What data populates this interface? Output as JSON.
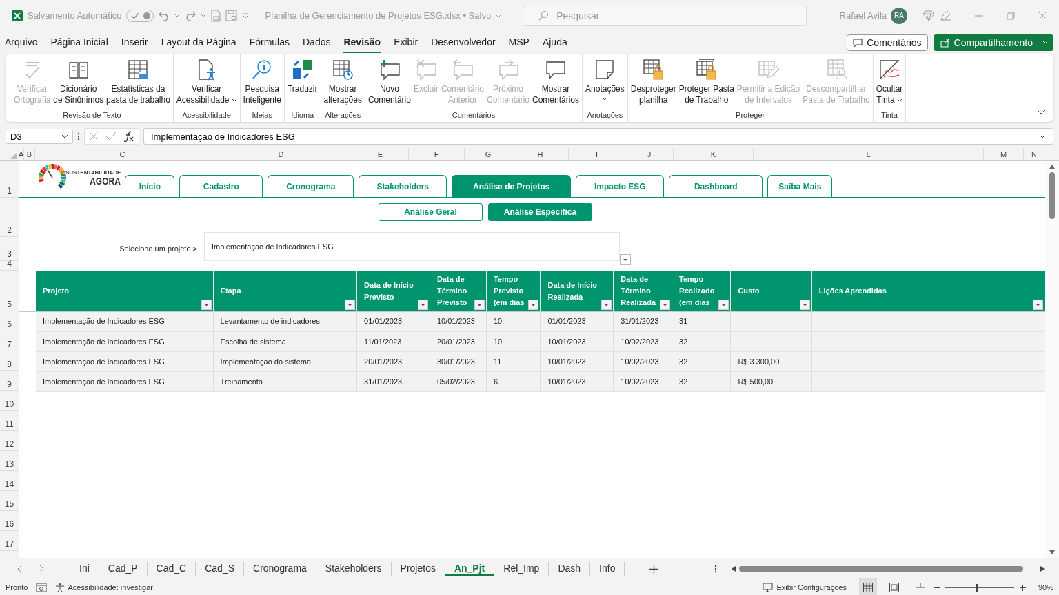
{
  "titlebar": {
    "autosave_label": "Salvamento Automático",
    "autosave_on": true,
    "file_title": "Planilha de Gerenciamento de Projetos ESG.xlsx • Salvo",
    "search_placeholder": "Pesquisar",
    "user_name": "Rafael Avila",
    "avatar_initials": "RA"
  },
  "menu": [
    {
      "label": "Arquivo",
      "selected": false
    },
    {
      "label": "Página Inicial",
      "selected": false
    },
    {
      "label": "Inserir",
      "selected": false
    },
    {
      "label": "Layout da Página",
      "selected": false
    },
    {
      "label": "Fórmulas",
      "selected": false
    },
    {
      "label": "Dados",
      "selected": false
    },
    {
      "label": "Revisão",
      "selected": true
    },
    {
      "label": "Exibir",
      "selected": false
    },
    {
      "label": "Desenvolvedor",
      "selected": false
    },
    {
      "label": "MSP",
      "selected": false
    },
    {
      "label": "Ajuda",
      "selected": false
    }
  ],
  "menu_buttons": {
    "comments": "Comentários",
    "share": "Compartilhamento"
  },
  "ribbon": [
    {
      "label": "Revisão de Texto",
      "items": [
        {
          "lines": [
            "Verificar",
            "Ortografia"
          ],
          "disabled": true
        },
        {
          "lines": [
            "Dicionário",
            "de Sinônimos"
          ],
          "disabled": false
        },
        {
          "lines": [
            "Estatísticas da",
            "pasta de trabalho"
          ],
          "disabled": false
        }
      ]
    },
    {
      "label": "Acessibilidade",
      "items": [
        {
          "lines": [
            "Verificar",
            "Acessibilidade"
          ],
          "disabled": false,
          "dropdown": true
        }
      ]
    },
    {
      "label": "Ideias",
      "items": [
        {
          "lines": [
            "Pesquisa",
            "Inteligente"
          ],
          "disabled": false
        }
      ]
    },
    {
      "label": "Idioma",
      "items": [
        {
          "lines": [
            "Traduzir"
          ],
          "disabled": false
        }
      ]
    },
    {
      "label": "Alterações",
      "items": [
        {
          "lines": [
            "Mostrar",
            "alterações"
          ],
          "disabled": false
        }
      ]
    },
    {
      "label": "Comentários",
      "items": [
        {
          "lines": [
            "Novo",
            "Comentário"
          ],
          "disabled": false
        },
        {
          "lines": [
            "Excluir"
          ],
          "disabled": true
        },
        {
          "lines": [
            "Comentário",
            "Anterior"
          ],
          "disabled": true
        },
        {
          "lines": [
            "Próximo",
            "Comentário"
          ],
          "disabled": true
        },
        {
          "lines": [
            "Mostrar",
            "Comentários"
          ],
          "disabled": false
        }
      ]
    },
    {
      "label": "Anotações",
      "items": [
        {
          "lines": [
            "Anotações"
          ],
          "disabled": false,
          "dropdown": true
        }
      ]
    },
    {
      "label": "Proteger",
      "items": [
        {
          "lines": [
            "Desproteger",
            "planilha"
          ],
          "disabled": false
        },
        {
          "lines": [
            "Proteger Pasta",
            "de Trabalho"
          ],
          "disabled": false
        },
        {
          "lines": [
            "Permitir a Edição",
            "de Intervalos"
          ],
          "disabled": true
        },
        {
          "lines": [
            "Descompartilhar",
            "Pasta de Trabalho"
          ],
          "disabled": true
        }
      ]
    },
    {
      "label": "Tinta",
      "items": [
        {
          "lines": [
            "Ocultar",
            "Tinta"
          ],
          "disabled": false,
          "dropdown": true
        }
      ]
    }
  ],
  "formula_bar": {
    "name_box": "D3",
    "value": "Implementação de Indicadores ESG"
  },
  "columns": [
    "A",
    "B",
    "C",
    "D",
    "E",
    "F",
    "G",
    "H",
    "I",
    "J",
    "K",
    "L",
    "M",
    "N"
  ],
  "rows": [
    "1",
    "2",
    "3",
    "4",
    "5",
    "6",
    "7",
    "8",
    "9",
    "10",
    "11",
    "12",
    "13",
    "14",
    "15",
    "16",
    "17"
  ],
  "logo": {
    "top": "SUSTENTABILIDADE",
    "bottom": "AGORA"
  },
  "nav_tabs": [
    {
      "label": "Início",
      "selected": false
    },
    {
      "label": "Cadastro",
      "selected": false
    },
    {
      "label": "Cronograma",
      "selected": false
    },
    {
      "label": "Stakeholders",
      "selected": false
    },
    {
      "label": "Análise de Projetos",
      "selected": true
    },
    {
      "label": "Impacto ESG",
      "selected": false
    },
    {
      "label": "Dashboard",
      "selected": false
    },
    {
      "label": "Saiba Mais",
      "selected": false
    }
  ],
  "sub_tabs": [
    {
      "label": "Análise Geral",
      "selected": false
    },
    {
      "label": "Análise Específica",
      "selected": true
    }
  ],
  "selector": {
    "label": "Selecione um projeto >",
    "value": "Implementação de Indicadores ESG"
  },
  "table": {
    "columns": [
      {
        "lines": [
          "Projeto"
        ]
      },
      {
        "lines": [
          "Etapa"
        ]
      },
      {
        "lines": [
          "Data de Início",
          "Previsto"
        ]
      },
      {
        "lines": [
          "Data de",
          "Término",
          "Previsto"
        ]
      },
      {
        "lines": [
          "Tempo",
          "Previsto",
          "(em dias"
        ]
      },
      {
        "lines": [
          "Data de Início",
          "Realizada"
        ]
      },
      {
        "lines": [
          "Data de",
          "Término",
          "Realizada"
        ]
      },
      {
        "lines": [
          "Tempo",
          "Realizado",
          "(em dias"
        ]
      },
      {
        "lines": [
          "Custo"
        ]
      },
      {
        "lines": [
          "Lições Aprendidas"
        ]
      }
    ],
    "rows": [
      [
        "Implementação de Indicadores ESG",
        "Levantamento de indicadores",
        "01/01/2023",
        "10/01/2023",
        "10",
        "01/01/2023",
        "31/01/2023",
        "31",
        null,
        null
      ],
      [
        "Implementação de Indicadores ESG",
        "Escolha de sistema",
        "11/01/2023",
        "20/01/2023",
        "10",
        "10/01/2023",
        "10/02/2023",
        "32",
        null,
        null
      ],
      [
        "Implementação de Indicadores ESG",
        "Implementação do sistema",
        "20/01/2023",
        "30/01/2023",
        "11",
        "10/01/2023",
        "10/02/2023",
        "32",
        "R$ 3.300,00",
        null
      ],
      [
        "Implementação de Indicadores ESG",
        "Treinamento",
        "31/01/2023",
        "05/02/2023",
        "6",
        "10/01/2023",
        "10/02/2023",
        "32",
        "R$ 500,00",
        null
      ]
    ]
  },
  "sheet_tabs": [
    {
      "label": "Ini",
      "selected": false
    },
    {
      "label": "Cad_P",
      "selected": false
    },
    {
      "label": "Cad_C",
      "selected": false
    },
    {
      "label": "Cad_S",
      "selected": false
    },
    {
      "label": "Cronograma",
      "selected": false
    },
    {
      "label": "Stakeholders",
      "selected": false
    },
    {
      "label": "Projetos",
      "selected": false
    },
    {
      "label": "An_Pjt",
      "selected": true
    },
    {
      "label": "Rel_Imp",
      "selected": false
    },
    {
      "label": "Dash",
      "selected": false
    },
    {
      "label": "Info",
      "selected": false
    }
  ],
  "status_bar": {
    "ready": "Pronto",
    "accessibility": "Acessibilidade: investigar",
    "display_settings": "Exibir Configurações",
    "zoom": "90%",
    "zoom_slider": {
      "level": 0.45
    }
  }
}
